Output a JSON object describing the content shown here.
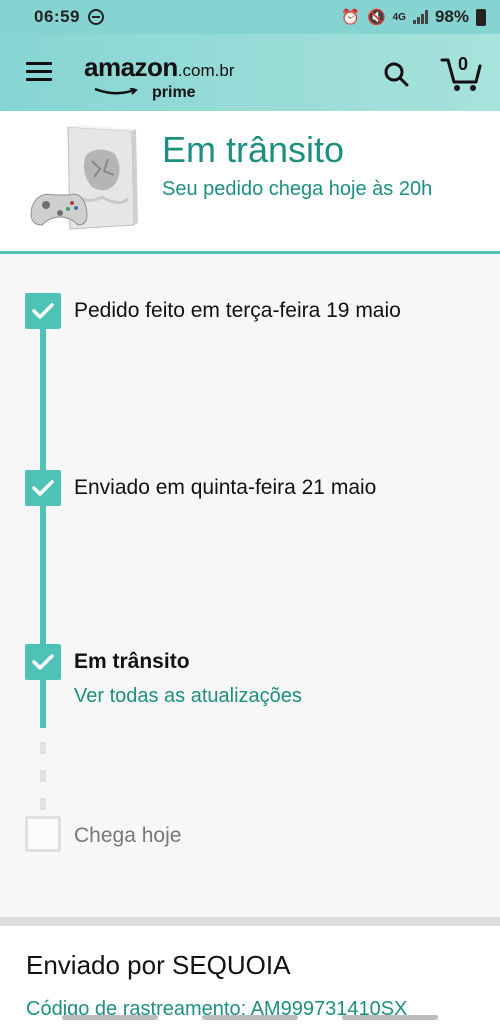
{
  "status_bar": {
    "time": "06:59",
    "network": "4G",
    "battery": "98%"
  },
  "header": {
    "logo_text": "amazon",
    "logo_domain": ".com.br",
    "logo_prime": "prime",
    "cart_count": "0",
    "icons": [
      "menu-icon",
      "search-icon",
      "cart-icon"
    ]
  },
  "banner": {
    "title": "Em trânsito",
    "subtitle": "Seu pedido chega hoje às 20h"
  },
  "timeline": {
    "steps": [
      {
        "label": "Pedido feito em terça-feira 19 maio",
        "done": true
      },
      {
        "label": "Enviado em quinta-feira 21 maio",
        "done": true
      },
      {
        "label": "Em trânsito",
        "done": true,
        "link": "Ver todas as atualizações"
      },
      {
        "label": "Chega hoje",
        "done": false
      }
    ]
  },
  "seller": {
    "title": "Enviado por SEQUOIA",
    "tracking_text": "Código de rastreamento: AM999731410SX"
  },
  "colors": {
    "accent": "#4fc2b7",
    "accent_text": "#1d8f80",
    "header_bg": "#86d5d3"
  }
}
